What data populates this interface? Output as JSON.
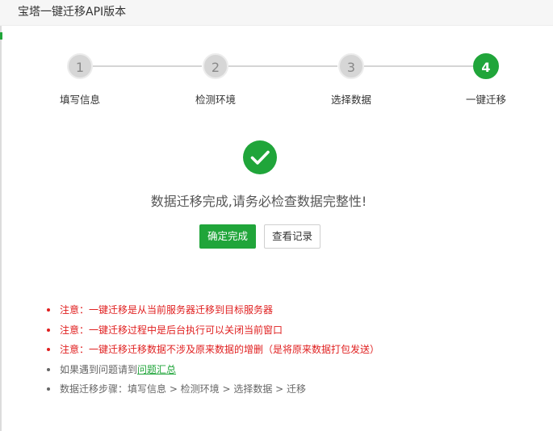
{
  "window": {
    "title": "宝塔一键迁移API版本"
  },
  "steps": [
    {
      "number": "1",
      "label": "填写信息"
    },
    {
      "number": "2",
      "label": "检测环境"
    },
    {
      "number": "3",
      "label": "选择数据"
    },
    {
      "number": "4",
      "label": "一键迁移"
    }
  ],
  "active_step": 4,
  "result": {
    "message": "数据迁移完成,请务必检查数据完整性!",
    "confirm_button": "确定完成",
    "view_log_button": "查看记录"
  },
  "notes": [
    {
      "text": "注意：一键迁移是从当前服务器迁移到目标服务器",
      "color": "#e02020"
    },
    {
      "text": "注意：一键迁移过程中是后台执行可以关闭当前窗口",
      "color": "#e02020"
    },
    {
      "text": "注意：一键迁移迁移数据不涉及原来数据的增删（是将原来数据打包发送）",
      "color": "#e02020"
    },
    {
      "text": "如果遇到问题请到",
      "link_text": "问题汇总",
      "color": "#666666"
    },
    {
      "text": "数据迁移步骤：填写信息 > 检测环境 > 选择数据 > 迁移",
      "color": "#666666"
    }
  ],
  "colors": {
    "accent": "#20a53a",
    "warning": "#e02020",
    "inactive_step": "#d6d6d6"
  },
  "icons": {
    "success": "checkmark-circle-icon"
  }
}
